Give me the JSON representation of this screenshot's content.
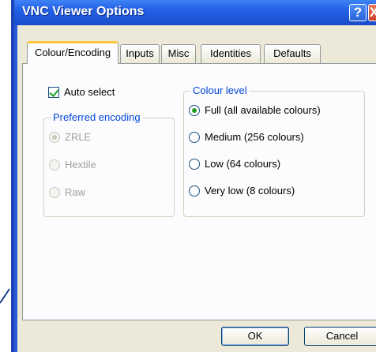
{
  "window": {
    "title": "VNC Viewer Options",
    "help_glyph": "?",
    "close_glyph": "X"
  },
  "tabs": [
    {
      "label": "Colour/Encoding",
      "active": true
    },
    {
      "label": "Inputs",
      "active": false
    },
    {
      "label": "Misc",
      "active": false
    },
    {
      "label": "Identities",
      "active": false
    },
    {
      "label": "Defaults",
      "active": false
    }
  ],
  "colour_encoding": {
    "auto_select": {
      "label": "Auto select",
      "checked": true
    },
    "preferred_encoding": {
      "legend": "Preferred encoding",
      "options": [
        {
          "label": "ZRLE",
          "selected": true,
          "enabled": false
        },
        {
          "label": "Hextile",
          "selected": false,
          "enabled": false
        },
        {
          "label": "Raw",
          "selected": false,
          "enabled": false
        }
      ]
    },
    "colour_level": {
      "legend": "Colour level",
      "options": [
        {
          "label": "Full (all available colours)",
          "selected": true
        },
        {
          "label": "Medium (256 colours)",
          "selected": false
        },
        {
          "label": "Low (64 colours)",
          "selected": false
        },
        {
          "label": "Very low (8 colours)",
          "selected": false
        }
      ]
    }
  },
  "buttons": {
    "ok": "OK",
    "cancel": "Cancel"
  },
  "colors": {
    "title_bar": "#2563e8",
    "dialog_face": "#ece9d8",
    "group_legend": "#0046d5",
    "active_tab_highlight": "#ffc83c",
    "check_green": "#21a121"
  }
}
